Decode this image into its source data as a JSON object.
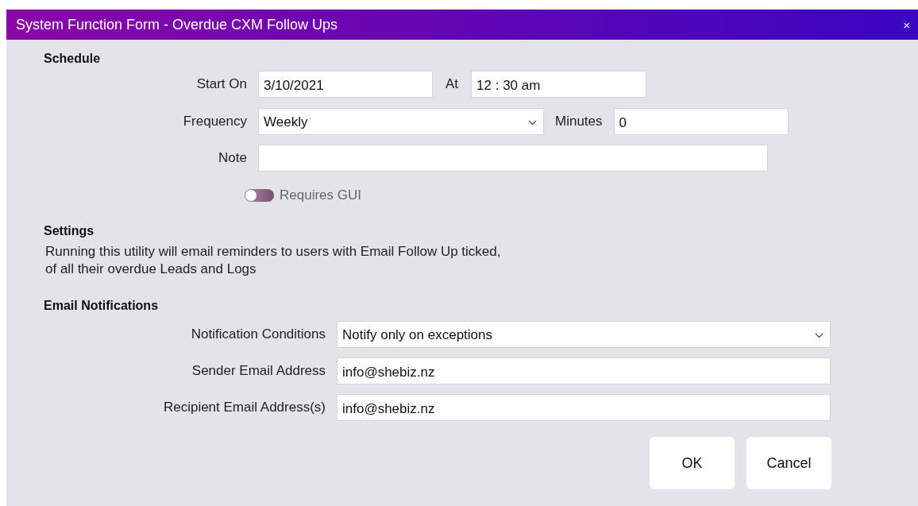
{
  "window": {
    "title": "System Function Form - Overdue CXM Follow Ups",
    "close": "×"
  },
  "schedule": {
    "heading": "Schedule",
    "start_on": {
      "label": "Start On",
      "value": "3/10/2021"
    },
    "at": {
      "label": "At",
      "value": "12 : 30 am"
    },
    "frequency": {
      "label": "Frequency",
      "value": "Weekly"
    },
    "minutes": {
      "label": "Minutes",
      "value": "0"
    },
    "note": {
      "label": "Note"
    },
    "requires_gui": {
      "label": "Requires GUI",
      "on": false
    }
  },
  "settings": {
    "heading": "Settings",
    "text": "Running this utility will email reminders to users with Email Follow Up ticked,\nof all their overdue Leads and Logs"
  },
  "email": {
    "heading": "Email Notifications",
    "fields": [
      {
        "kind": "select",
        "label": "Notification Conditions",
        "value": "Notify only on exceptions"
      },
      {
        "kind": "input",
        "label": "Sender Email Address",
        "value": "info@shebiz.nz"
      },
      {
        "kind": "input",
        "label": "Recipient Email Address(s)",
        "value": "info@shebiz.nz"
      }
    ]
  },
  "buttons": [
    "OK",
    "Cancel"
  ]
}
